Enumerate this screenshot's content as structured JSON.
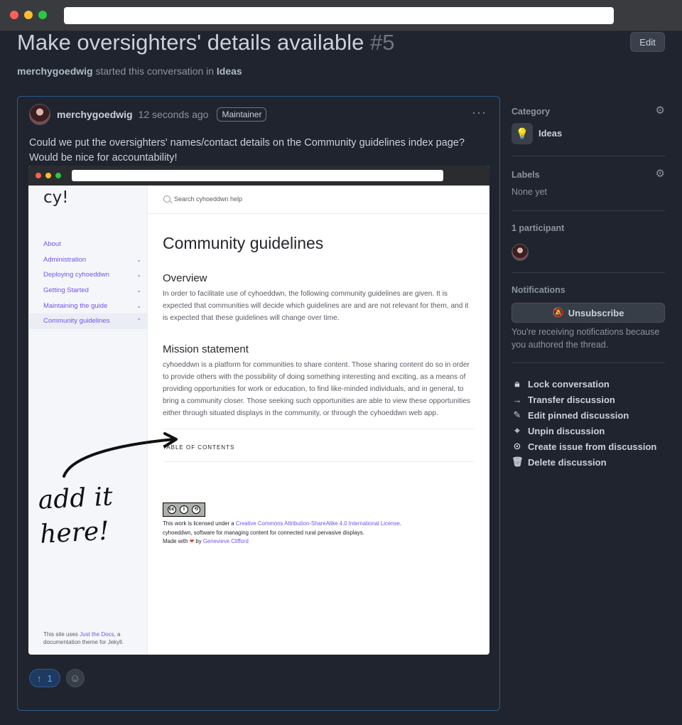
{
  "window": {
    "address": ""
  },
  "page": {
    "title": "Make oversighters' details available",
    "number": "#5",
    "edit_label": "Edit",
    "starter": "merchygoedwig",
    "started_text": "started this conversation in",
    "category_link": "Ideas"
  },
  "post": {
    "author": "merchygoedwig",
    "time_ago": "12 seconds ago",
    "role": "Maintainer",
    "more_icon": "kebab-horizontal-icon",
    "body_line1": "Could we put the oversighters' names/contact details on the Community guidelines index page?",
    "body_line2": "Would be nice for accountability!",
    "upvotes": "1",
    "upvote_icon": "arrow-up-icon",
    "emoji_icon": "smiley-icon"
  },
  "screenshot": {
    "logo": "cy!",
    "search_placeholder": "Search cyhoeddwn help",
    "nav": [
      {
        "label": "About",
        "chevron": ""
      },
      {
        "label": "Administration",
        "chevron": "⌄"
      },
      {
        "label": "Deploying cyhoeddwn",
        "chevron": "⌄"
      },
      {
        "label": "Getting Started",
        "chevron": "⌄"
      },
      {
        "label": "Maintaining the guide",
        "chevron": "⌄"
      },
      {
        "label": "Community guidelines",
        "chevron": "⌃"
      }
    ],
    "sidebar_footer_pre": "This site uses ",
    "sidebar_footer_link": "Just the Docs",
    "sidebar_footer_post": ", a documentation theme for Jekyll.",
    "heading": "Community guidelines",
    "overview_heading": "Overview",
    "overview_text": "In order to facilitate use of cyhoeddwn, the following community guidelines are given. It is expected that communities will decide which guidelines are and are not relevant for them, and it is expected that these guidelines will change over time.",
    "mission_heading": "Mission statement",
    "mission_text": "cyhoeddwn is a platform for communities to share content. Those sharing content do so in order to provide others with the possibility of doing something interesting and exciting, as a means of providing opportunities for work or education, to find like-minded individuals, and in general, to bring a community closer. Those seeking such opportunities are able to view these opportunities either through situated displays in the community, or through the cyhoeddwn web app.",
    "toc_label": "TABLE OF CONTENTS",
    "license_pre": "This work is licensed under a ",
    "license_link": "Creative Commons Attribution-ShareAlike 4.0 International License",
    "license_post": ".",
    "tagline": "cyhoeddwn, software for managing content for connected rural pervasive displays.",
    "made_with_pre": "Made with ",
    "made_with_by": " by ",
    "made_with_link": "Genevieve Clifford",
    "handwriting_line1": "add it",
    "handwriting_line2": "here!"
  },
  "sidebar": {
    "category_heading": "Category",
    "category_name": "Ideas",
    "category_icon": "lightbulb-icon",
    "labels_heading": "Labels",
    "labels_value": "None yet",
    "participants_heading": "1 participant",
    "notifications_heading": "Notifications",
    "unsubscribe_label": "Unsubscribe",
    "notifications_reason": "You're receiving notifications because you authored the thread.",
    "actions": [
      {
        "label": "Lock conversation",
        "icon": "lock-icon"
      },
      {
        "label": "Transfer discussion",
        "icon": "arrow-right-icon"
      },
      {
        "label": "Edit pinned discussion",
        "icon": "pencil-icon"
      },
      {
        "label": "Unpin discussion",
        "icon": "pin-slash-icon"
      },
      {
        "label": "Create issue from discussion",
        "icon": "issue-opened-icon"
      },
      {
        "label": "Delete discussion",
        "icon": "trash-icon"
      }
    ]
  }
}
